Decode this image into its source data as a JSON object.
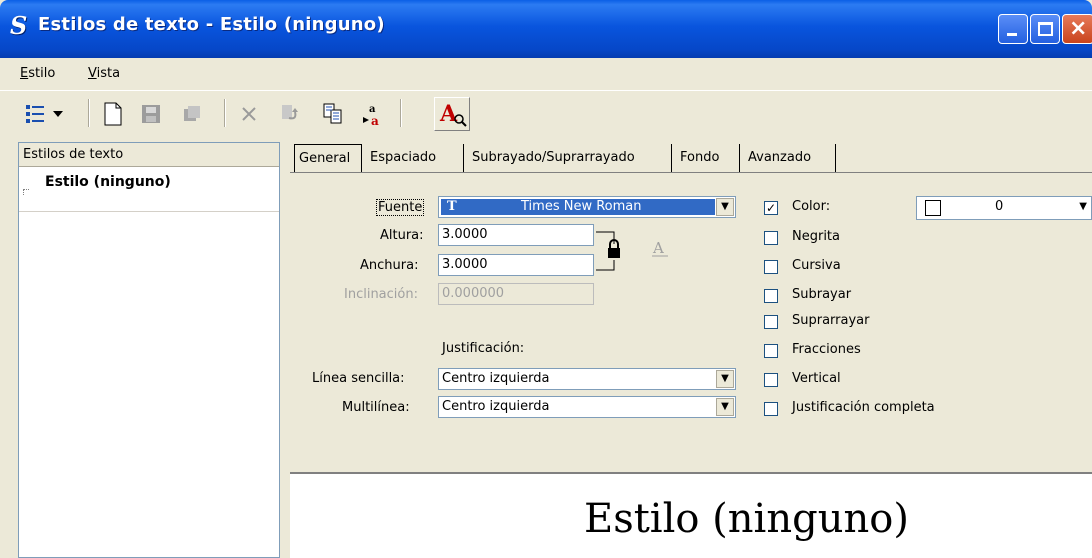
{
  "window": {
    "title": "Estilos de texto - Estilo (ninguno)",
    "app_icon": "microstation-s-icon"
  },
  "menubar": {
    "items": [
      "Estilo",
      "Vista"
    ]
  },
  "toolbar": {
    "tools": [
      "tree-view-icon",
      "dropdown-arrow-icon",
      "new-style-icon",
      "save-icon",
      "copy-icon",
      "delete-icon",
      "import-icon",
      "export-icon",
      "sync-icon",
      "text-style-icon"
    ]
  },
  "left_panel": {
    "header": "Estilos de texto",
    "items": [
      "Estilo (ninguno)"
    ]
  },
  "tabs": [
    "General",
    "Espaciado",
    "Subrayado/Suprarrayado",
    "Fondo",
    "Avanzado"
  ],
  "general": {
    "font_label": "Fuente",
    "font_value": "Times New Roman",
    "font_type_icon": "truetype-icon",
    "height_label": "Altura:",
    "height_value": "3.0000",
    "width_label": "Anchura:",
    "width_value": "3.0000",
    "slant_label": "Inclinación:",
    "slant_value": "0.000000",
    "justification_heading": "Justificación:",
    "single_line_label": "Línea sencilla:",
    "single_line_value": "Centro izquierda",
    "multiline_label": "Multilínea:",
    "multiline_value": "Centro izquierda",
    "lock_icon": "lock-icon"
  },
  "options": {
    "color_label": "Color:",
    "color_checked": true,
    "color_value": "0",
    "checkboxes": [
      "Negrita",
      "Cursiva",
      "Subrayar",
      "Suprarrayar",
      "Fracciones",
      "Vertical",
      "Justificación completa"
    ]
  },
  "preview": {
    "text": "Estilo (ninguno)"
  }
}
